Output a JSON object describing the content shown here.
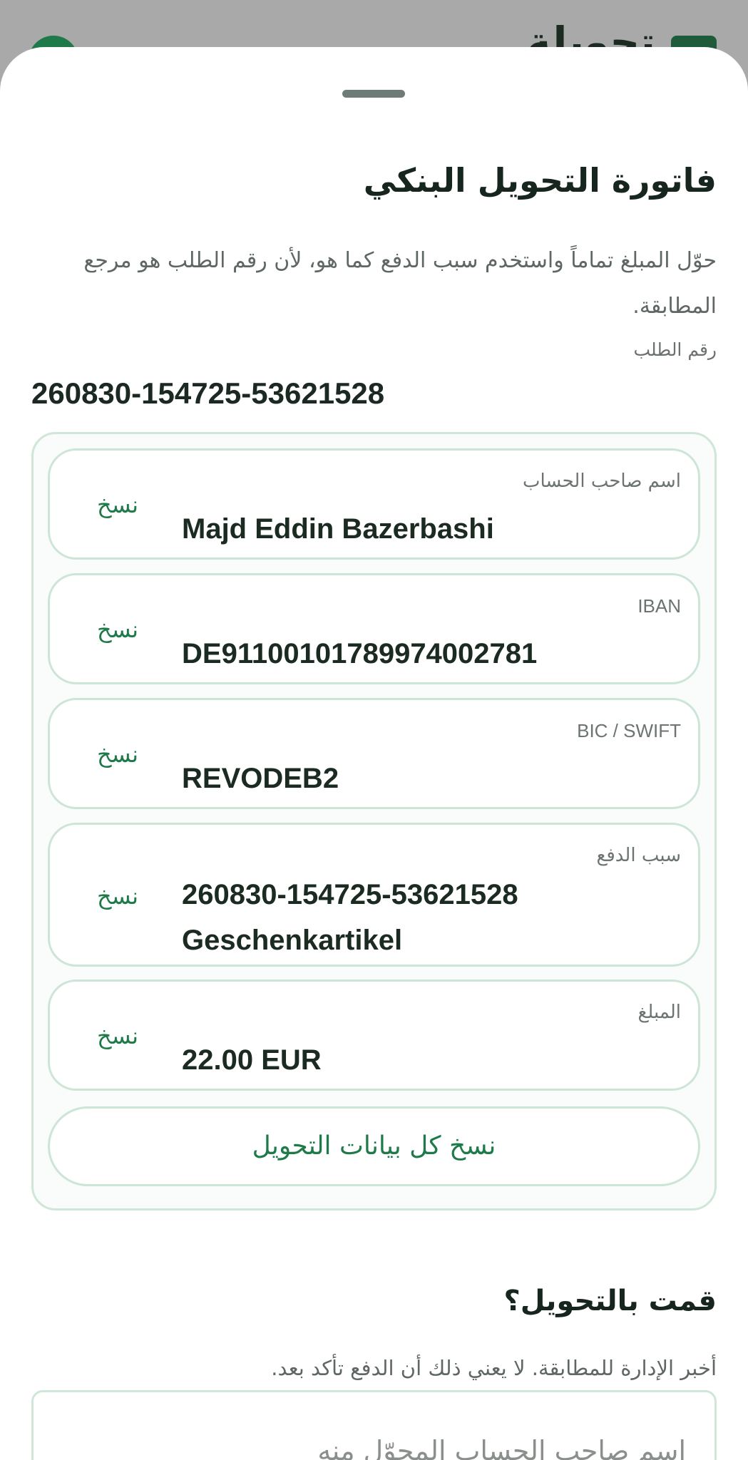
{
  "background": {
    "title": "تحويلة"
  },
  "sheet": {
    "title": "فاتورة التحويل البنكي",
    "description": "حوّل المبلغ تماماً واستخدم سبب الدفع كما هو، لأن رقم الطلب هو مرجع المطابقة.",
    "order_label": "رقم الطلب",
    "order_number": "260830-154725-53621528"
  },
  "fields": [
    {
      "label": "اسم صاحب الحساب",
      "value": "Majd Eddin Bazerbashi",
      "copy": "نسخ"
    },
    {
      "label": "IBAN",
      "value": "DE91100101789974002781",
      "copy": "نسخ"
    },
    {
      "label": "BIC / SWIFT",
      "value": "REVODEB2",
      "copy": "نسخ"
    },
    {
      "label": "سبب الدفع",
      "value": "260830-154725-53621528 Geschenkartikel",
      "copy": "نسخ"
    },
    {
      "label": "المبلغ",
      "value": "22.00 EUR",
      "copy": "نسخ"
    }
  ],
  "copy_all_label": "نسخ كل بيانات التحويل",
  "confirm": {
    "title": "قمت بالتحويل؟",
    "description": "أخبر الإدارة للمطابقة. لا يعني ذلك أن الدفع تأكد بعد.",
    "sender_placeholder": "اسم صاحب الحساب المحوّل منه"
  },
  "colors": {
    "accent": "#1f7a49",
    "border": "#cde5d6",
    "text": "#1b2b22"
  }
}
